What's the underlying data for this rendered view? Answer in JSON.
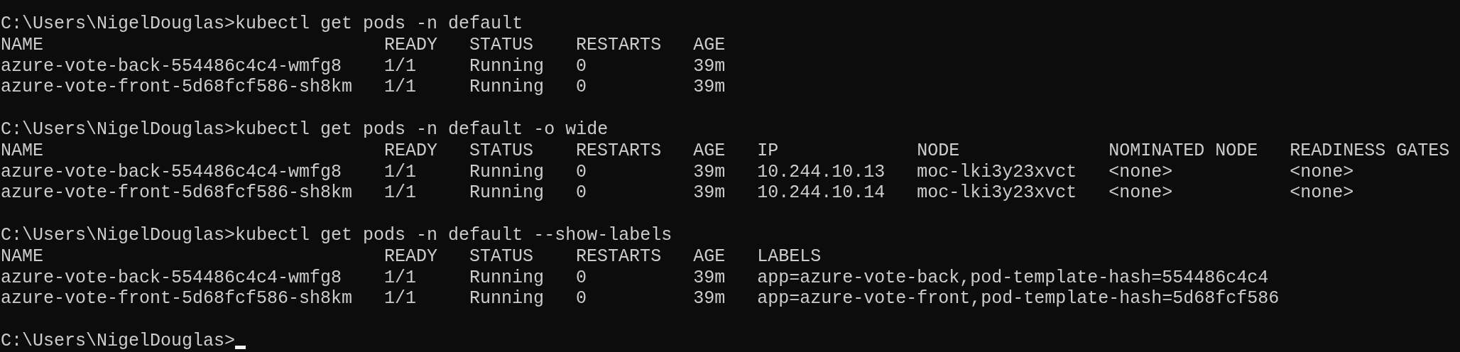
{
  "terminal": {
    "blocks": [
      {
        "prompt": "C:\\Users\\NigelDouglas>",
        "command": "kubectl get pods -n default",
        "columns": [
          "NAME",
          "READY",
          "STATUS",
          "RESTARTS",
          "AGE"
        ],
        "rows": [
          [
            "azure-vote-back-554486c4c4-wmfg8",
            "1/1",
            "Running",
            "0",
            "39m"
          ],
          [
            "azure-vote-front-5d68fcf586-sh8km",
            "1/1",
            "Running",
            "0",
            "39m"
          ]
        ]
      },
      {
        "prompt": "C:\\Users\\NigelDouglas>",
        "command": "kubectl get pods -n default -o wide",
        "columns": [
          "NAME",
          "READY",
          "STATUS",
          "RESTARTS",
          "AGE",
          "IP",
          "NODE",
          "NOMINATED NODE",
          "READINESS GATES"
        ],
        "rows": [
          [
            "azure-vote-back-554486c4c4-wmfg8",
            "1/1",
            "Running",
            "0",
            "39m",
            "10.244.10.13",
            "moc-lki3y23xvct",
            "<none>",
            "<none>"
          ],
          [
            "azure-vote-front-5d68fcf586-sh8km",
            "1/1",
            "Running",
            "0",
            "39m",
            "10.244.10.14",
            "moc-lki3y23xvct",
            "<none>",
            "<none>"
          ]
        ]
      },
      {
        "prompt": "C:\\Users\\NigelDouglas>",
        "command": "kubectl get pods -n default --show-labels",
        "columns": [
          "NAME",
          "READY",
          "STATUS",
          "RESTARTS",
          "AGE",
          "LABELS"
        ],
        "rows": [
          [
            "azure-vote-back-554486c4c4-wmfg8",
            "1/1",
            "Running",
            "0",
            "39m",
            "app=azure-vote-back,pod-template-hash=554486c4c4"
          ],
          [
            "azure-vote-front-5d68fcf586-sh8km",
            "1/1",
            "Running",
            "0",
            "39m",
            "app=azure-vote-front,pod-template-hash=5d68fcf586"
          ]
        ]
      }
    ],
    "final_prompt": "C:\\Users\\NigelDouglas>"
  }
}
